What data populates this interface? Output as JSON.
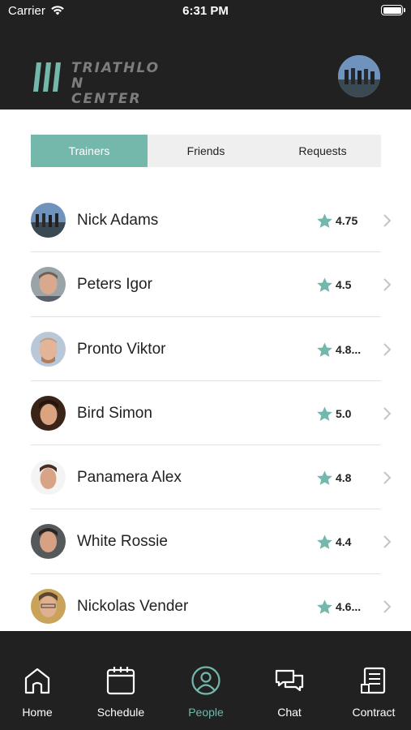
{
  "status_bar": {
    "carrier": "Carrier",
    "time": "6:31 PM"
  },
  "header": {
    "logo_line1": "TRIATHLO N",
    "logo_line2": "CENTER",
    "avatar_icon": "profile-photo"
  },
  "tabs": [
    {
      "label": "Trainers",
      "active": true
    },
    {
      "label": "Friends",
      "active": false
    },
    {
      "label": "Requests",
      "active": false
    }
  ],
  "trainers": [
    {
      "name": "Nick Adams",
      "rating": "4.75"
    },
    {
      "name": "Peters Igor",
      "rating": "4.5"
    },
    {
      "name": "Pronto Viktor",
      "rating": "4.8..."
    },
    {
      "name": "Bird Simon",
      "rating": "5.0"
    },
    {
      "name": "Panamera Alex",
      "rating": "4.8"
    },
    {
      "name": "White Rossie",
      "rating": "4.4"
    },
    {
      "name": "Nickolas Vender",
      "rating": "4.6..."
    }
  ],
  "tabbar": [
    {
      "label": "Home",
      "icon": "home-icon",
      "active": false
    },
    {
      "label": "Schedule",
      "icon": "calendar-icon",
      "active": false
    },
    {
      "label": "People",
      "icon": "person-icon",
      "active": true
    },
    {
      "label": "Chat",
      "icon": "chat-icon",
      "active": false
    },
    {
      "label": "Contract",
      "icon": "document-icon",
      "active": false
    }
  ],
  "colors": {
    "accent": "#74b8ab",
    "dark": "#212121",
    "tab_bg": "#efefef"
  }
}
